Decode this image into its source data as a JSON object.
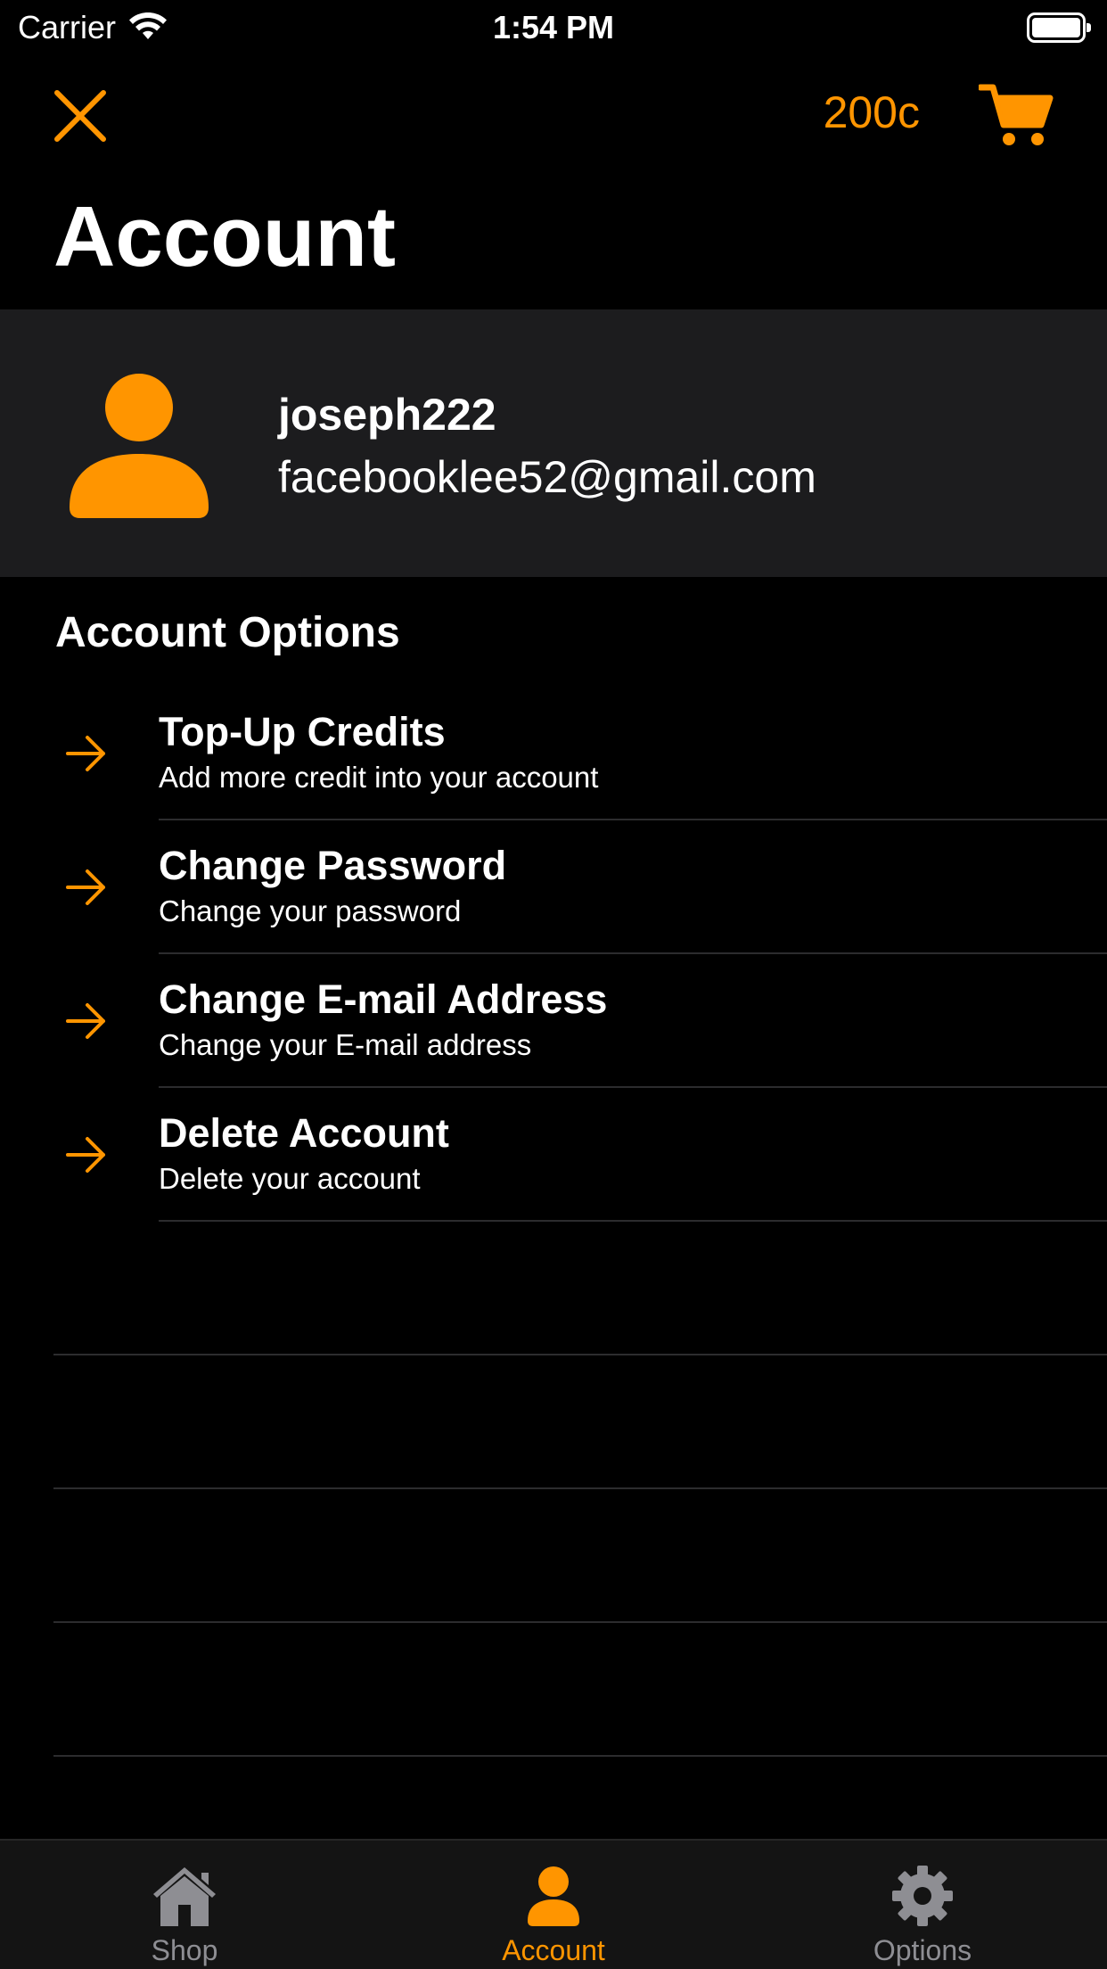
{
  "status_bar": {
    "carrier": "Carrier",
    "time": "1:54 PM"
  },
  "nav": {
    "credits": "200c",
    "close_icon": "close-icon",
    "cart_icon": "cart-icon"
  },
  "page_title": "Account",
  "profile": {
    "username": "joseph222",
    "email": "facebooklee52@gmail.com",
    "avatar_icon": "person-icon"
  },
  "section_title": "Account Options",
  "options": [
    {
      "title": "Top-Up Credits",
      "subtitle": "Add more credit into your account"
    },
    {
      "title": "Change Password",
      "subtitle": "Change your password"
    },
    {
      "title": "Change E-mail Address",
      "subtitle": "Change your E-mail address"
    },
    {
      "title": "Delete Account",
      "subtitle": "Delete your account"
    }
  ],
  "tabs": [
    {
      "label": "Shop",
      "icon": "house-icon",
      "active": false
    },
    {
      "label": "Account",
      "icon": "person-icon",
      "active": true
    },
    {
      "label": "Options",
      "icon": "gear-icon",
      "active": false
    }
  ],
  "colors": {
    "accent": "#FF9500",
    "background": "#000000",
    "card": "#1C1C1E",
    "inactive_tab": "#8E8E93"
  }
}
